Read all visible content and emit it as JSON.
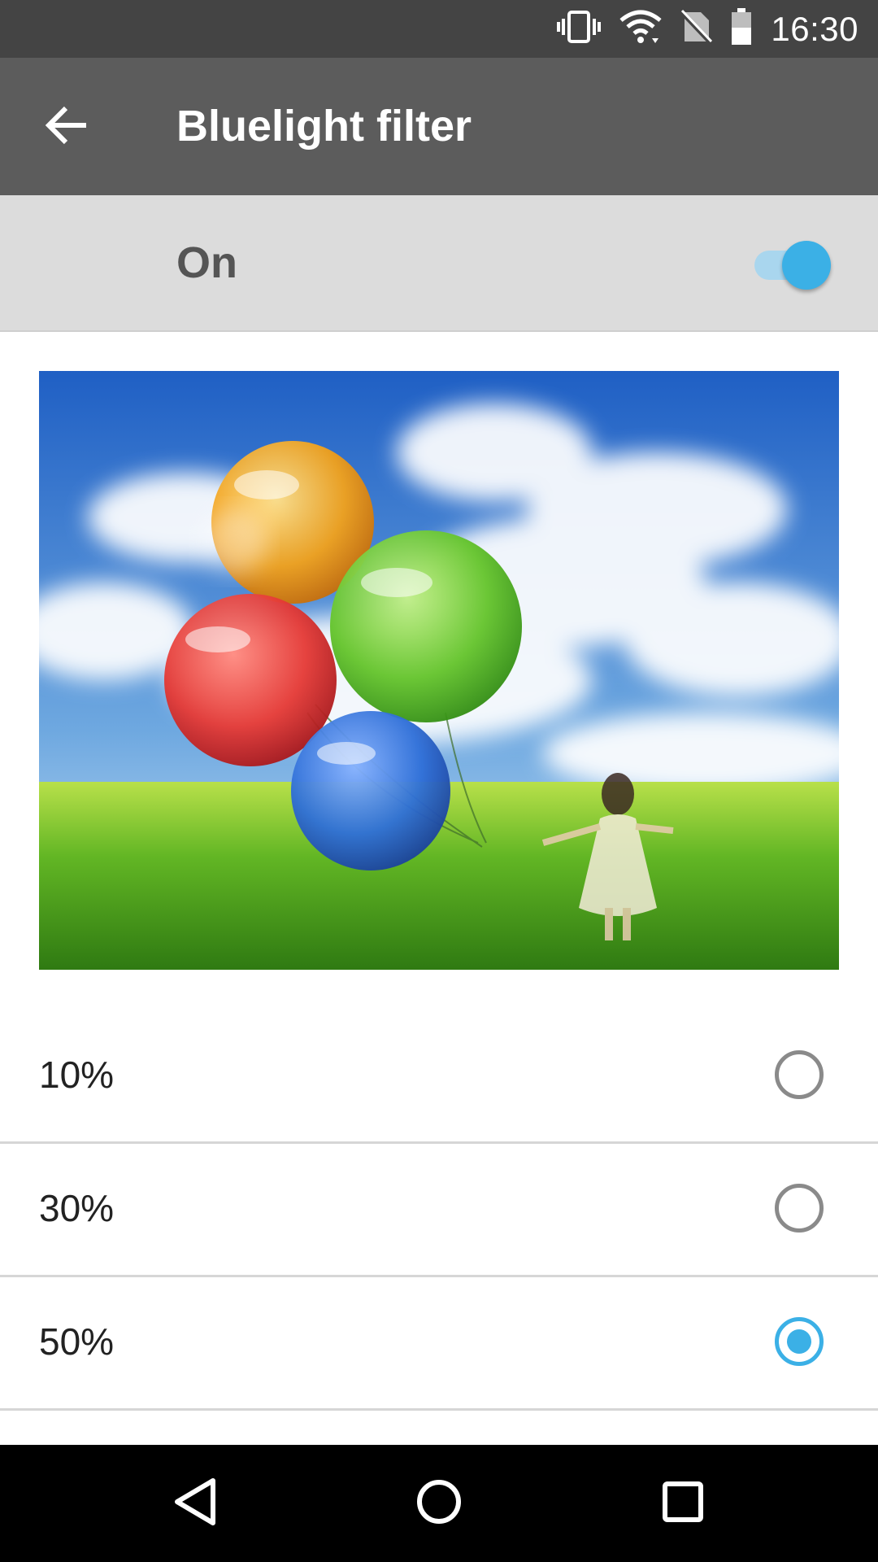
{
  "status_bar": {
    "time": "16:30",
    "icons": [
      "vibrate-icon",
      "wifi-icon",
      "no-sim-icon",
      "battery-icon"
    ]
  },
  "app_bar": {
    "title": "Bluelight filter",
    "back_icon": "arrow-back-icon"
  },
  "master_switch": {
    "label": "On",
    "enabled": true
  },
  "preview": {
    "icon": "preview-image"
  },
  "options": [
    {
      "label": "10%",
      "selected": false
    },
    {
      "label": "30%",
      "selected": false
    },
    {
      "label": "50%",
      "selected": true
    }
  ],
  "nav_bar": {
    "icons": [
      "back-triangle-icon",
      "home-circle-icon",
      "recents-square-icon"
    ]
  },
  "colors": {
    "status_bar": "#444444",
    "app_bar": "#5c5c5c",
    "accent": "#3bb0e6",
    "master_row": "#dcdcdc"
  }
}
